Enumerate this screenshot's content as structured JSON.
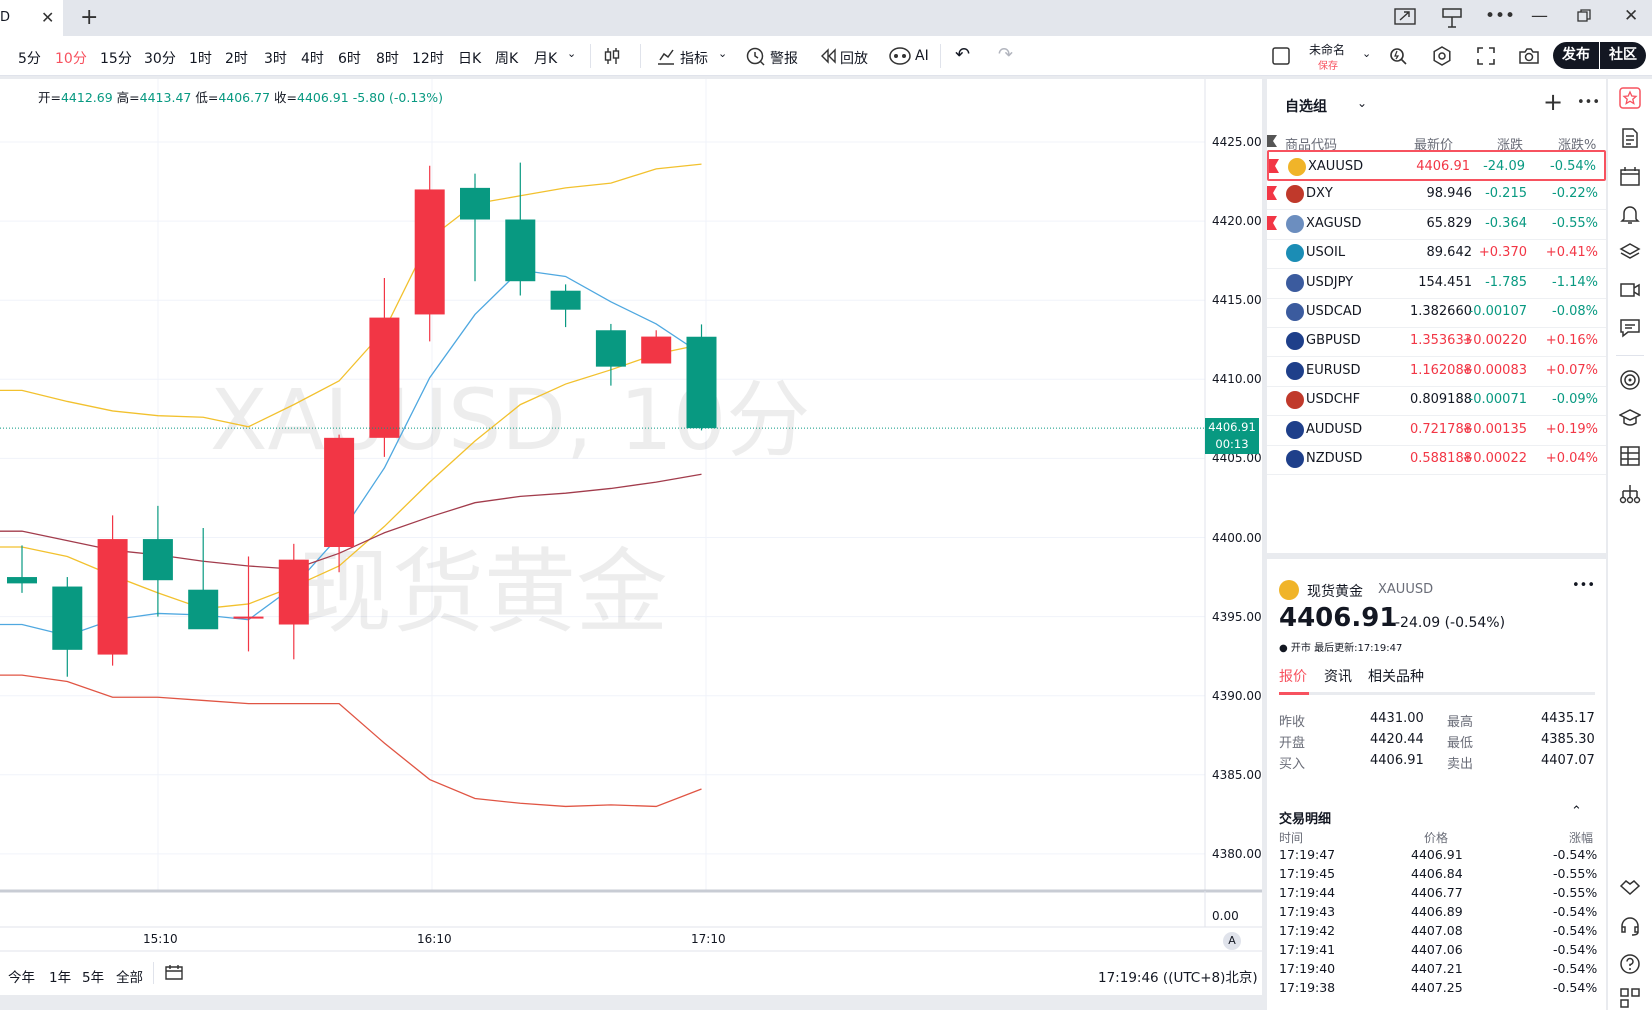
{
  "tab": {
    "title": "D"
  },
  "toolbar": {
    "intervals": [
      "5分",
      "10分",
      "15分",
      "30分",
      "1时",
      "2时",
      "3时",
      "4时",
      "6时",
      "8时",
      "12时",
      "日K",
      "周K",
      "月K"
    ],
    "active_interval": "10分",
    "indicators_label": "指标",
    "alert_label": "警报",
    "replay_label": "回放",
    "ai_label": "AI",
    "layout_name": "未命名",
    "layout_status": "保存",
    "publish_label": "发布",
    "community_label": "社区"
  },
  "legend": {
    "open_label": "开=",
    "open": "4412.69",
    "high_label": "高=",
    "high": "4413.47",
    "low_label": "低=",
    "low": "4406.77",
    "close_label": "收=",
    "close": "4406.91",
    "change": "-5.80 (-0.13%)"
  },
  "watermark": {
    "symbol": "XAUUSD, 10分",
    "name": "现货黄金"
  },
  "price_tag": {
    "price": "4406.91",
    "countdown": "00:13"
  },
  "bottom": {
    "ranges": [
      "今年",
      "1年",
      "5年",
      "全部"
    ],
    "clock": "17:19:46 ((UTC+8)北京)",
    "volume_axis": "0.00",
    "auto_label": "A"
  },
  "chart_data": {
    "type": "candlestick",
    "symbol": "XAUUSD",
    "interval": "10分",
    "y_ticks": [
      4425.0,
      4420.0,
      4415.0,
      4410.0,
      4405.0,
      4400.0,
      4395.0,
      4390.0,
      4385.0,
      4380.0
    ],
    "ylim": [
      4378,
      4428
    ],
    "x_ticks": [
      "15:10",
      "16:10",
      "17:10"
    ],
    "candles": [
      {
        "o": 4397.5,
        "h": 4399.5,
        "l": 4396.5,
        "c": 4397.1
      },
      {
        "o": 4396.9,
        "h": 4397.5,
        "l": 4391.2,
        "c": 4392.9
      },
      {
        "o": 4392.6,
        "h": 4401.4,
        "l": 4391.9,
        "c": 4399.9
      },
      {
        "o": 4399.9,
        "h": 4402.0,
        "l": 4395.0,
        "c": 4397.3
      },
      {
        "o": 4396.7,
        "h": 4400.6,
        "l": 4394.9,
        "c": 4394.2
      },
      {
        "o": 4395.0,
        "h": 4398.8,
        "l": 4392.8,
        "c": 4395.0
      },
      {
        "o": 4394.5,
        "h": 4399.6,
        "l": 4392.3,
        "c": 4398.6
      },
      {
        "o": 4399.4,
        "h": 4406.5,
        "l": 4397.8,
        "c": 4406.3
      },
      {
        "o": 4406.3,
        "h": 4416.4,
        "l": 4405.1,
        "c": 4413.9
      },
      {
        "o": 4414.1,
        "h": 4423.5,
        "l": 4412.4,
        "c": 4422.0
      },
      {
        "o": 4422.1,
        "h": 4423.0,
        "l": 4416.2,
        "c": 4420.1
      },
      {
        "o": 4420.1,
        "h": 4423.7,
        "l": 4415.3,
        "c": 4416.2
      },
      {
        "o": 4415.6,
        "h": 4416.0,
        "l": 4413.3,
        "c": 4414.4
      },
      {
        "o": 4413.1,
        "h": 4413.5,
        "l": 4409.6,
        "c": 4410.8
      },
      {
        "o": 4411.0,
        "h": 4413.1,
        "l": 4411.1,
        "c": 4412.7
      },
      {
        "o": 4412.69,
        "h": 4413.47,
        "l": 4406.77,
        "c": 4406.91
      }
    ],
    "overlays": [
      {
        "name": "upper",
        "color": "#f2c12e",
        "values": [
          4409.3,
          4408.6,
          4408.0,
          4407.7,
          4407.6,
          4407.0,
          4408.4,
          4409.9,
          4413.1,
          4418.9,
          4421.1,
          4421.6,
          4422.1,
          4422.4,
          4423.3,
          4423.6
        ]
      },
      {
        "name": "ma_slow",
        "color": "#f2c12e",
        "values": [
          4399.4,
          4398.8,
          4397.6,
          4396.5,
          4395.5,
          4395.8,
          4396.9,
          4398.2,
          4400.7,
          4403.5,
          4406.1,
          4408.4,
          4409.7,
          4410.6,
          4411.6,
          4412.2
        ]
      },
      {
        "name": "ma_fast",
        "color": "#4fa8e0",
        "values": [
          4394.5,
          4393.8,
          4394.8,
          4395.2,
          4395.1,
          4394.8,
          4396.9,
          4400.1,
          4404.4,
          4410.1,
          4414.1,
          4416.9,
          4416.5,
          4414.9,
          4413.5,
          4411.6
        ]
      },
      {
        "name": "basis",
        "color": "#a23c4c",
        "values": [
          4400.4,
          4399.8,
          4399.2,
          4398.9,
          4398.5,
          4398.2,
          4398.0,
          4399.0,
          4400.3,
          4401.3,
          4402.2,
          4402.6,
          4402.8,
          4403.1,
          4403.5,
          4404.0
        ]
      },
      {
        "name": "lower",
        "color": "#e05544",
        "values": [
          4391.3,
          4390.9,
          4389.9,
          4389.9,
          4389.7,
          4389.5,
          4389.5,
          4389.5,
          4387.0,
          4384.7,
          4383.5,
          4383.2,
          4383.0,
          4383.1,
          4383.0,
          4384.1
        ]
      }
    ]
  },
  "watchlist": {
    "title": "自选组",
    "columns": [
      "商品代码",
      "最新价",
      "涨跌",
      "涨跌%"
    ],
    "rows": [
      {
        "sym": "XAUUSD",
        "px": "4406.91",
        "ch": "-24.09",
        "pct": "-0.54%",
        "dir": "down",
        "flag": true,
        "icon_color": "#f0b429"
      },
      {
        "sym": "DXY",
        "px": "98.946",
        "ch": "-0.215",
        "pct": "-0.22%",
        "dir": "down",
        "flag": true,
        "icon_color": "#c0392b"
      },
      {
        "sym": "XAGUSD",
        "px": "65.829",
        "ch": "-0.364",
        "pct": "-0.55%",
        "dir": "down",
        "flag": true,
        "icon_color": "#6c8ebf"
      },
      {
        "sym": "USOIL",
        "px": "89.642",
        "ch": "+0.370",
        "pct": "+0.41%",
        "dir": "up",
        "flag": false,
        "icon_color": "#1b8db5"
      },
      {
        "sym": "USDJPY",
        "px": "154.451",
        "ch": "-1.785",
        "pct": "-1.14%",
        "dir": "down",
        "flag": false,
        "icon_color": "#3b5b9e"
      },
      {
        "sym": "USDCAD",
        "px": "1.382660",
        "ch": "-0.00107",
        "pct": "-0.08%",
        "dir": "down",
        "flag": false,
        "icon_color": "#3b5b9e"
      },
      {
        "sym": "GBPUSD",
        "px": "1.353633",
        "ch": "+0.00220",
        "pct": "+0.16%",
        "dir": "up",
        "flag": false,
        "icon_color": "#1e3f8a"
      },
      {
        "sym": "EURUSD",
        "px": "1.162088",
        "ch": "+0.00083",
        "pct": "+0.07%",
        "dir": "up",
        "flag": false,
        "icon_color": "#1e3f8a"
      },
      {
        "sym": "USDCHF",
        "px": "0.809188",
        "ch": "-0.00071",
        "pct": "-0.09%",
        "dir": "down",
        "flag": false,
        "icon_color": "#c0392b"
      },
      {
        "sym": "AUDUSD",
        "px": "0.721788",
        "ch": "+0.00135",
        "pct": "+0.19%",
        "dir": "up",
        "flag": false,
        "icon_color": "#1e3f8a"
      },
      {
        "sym": "NZDUSD",
        "px": "0.588188",
        "ch": "+0.00022",
        "pct": "+0.04%",
        "dir": "up",
        "flag": false,
        "icon_color": "#1e3f8a"
      }
    ]
  },
  "detail": {
    "name": "现货黄金",
    "symbol": "XAUUSD",
    "price": "4406.91",
    "change": "-24.09 (-0.54%)",
    "status": "● 开市 最后更新:17:19:47",
    "tabs": [
      "报价",
      "资讯",
      "相关品种"
    ],
    "stats": {
      "prev_close_label": "昨收",
      "prev_close": "4431.00",
      "high_label": "最高",
      "high": "4435.17",
      "open_label": "开盘",
      "open": "4420.44",
      "low_label": "最低",
      "low": "4385.30",
      "bid_label": "买入",
      "bid": "4406.91",
      "ask_label": "卖出",
      "ask": "4407.07"
    },
    "trades_title": "交易明细",
    "trades_columns": [
      "时间",
      "价格",
      "涨幅"
    ],
    "trades": [
      {
        "t": "17:19:47",
        "p": "4406.91",
        "c": "-0.54%"
      },
      {
        "t": "17:19:45",
        "p": "4406.84",
        "c": "-0.55%"
      },
      {
        "t": "17:19:44",
        "p": "4406.77",
        "c": "-0.55%"
      },
      {
        "t": "17:19:43",
        "p": "4406.89",
        "c": "-0.54%"
      },
      {
        "t": "17:19:42",
        "p": "4407.08",
        "c": "-0.54%"
      },
      {
        "t": "17:19:41",
        "p": "4407.06",
        "c": "-0.54%"
      },
      {
        "t": "17:19:40",
        "p": "4407.21",
        "c": "-0.54%"
      },
      {
        "t": "17:19:38",
        "p": "4407.25",
        "c": "-0.54%"
      }
    ]
  },
  "colors": {
    "up": "#f23645",
    "down": "#089981",
    "accent": "#f7525f"
  }
}
